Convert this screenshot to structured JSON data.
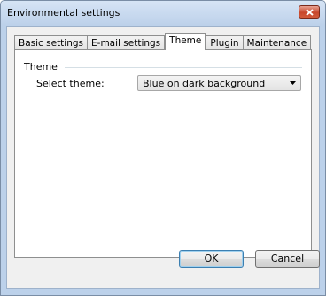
{
  "window": {
    "title": "Environmental settings"
  },
  "tabs": [
    {
      "label": "Basic settings",
      "active": false
    },
    {
      "label": "E-mail settings",
      "active": false
    },
    {
      "label": "Theme",
      "active": true
    },
    {
      "label": "Plugin",
      "active": false
    },
    {
      "label": "Maintenance",
      "active": false
    }
  ],
  "theme": {
    "group_label": "Theme",
    "select_label": "Select theme:",
    "select_value": "Blue on dark background"
  },
  "buttons": {
    "ok_label": "OK",
    "cancel_label": "Cancel"
  },
  "colors": {
    "titlebar": "#bdd1ea",
    "close_button": "#c8472c",
    "client_background": "#f0f0f0"
  }
}
